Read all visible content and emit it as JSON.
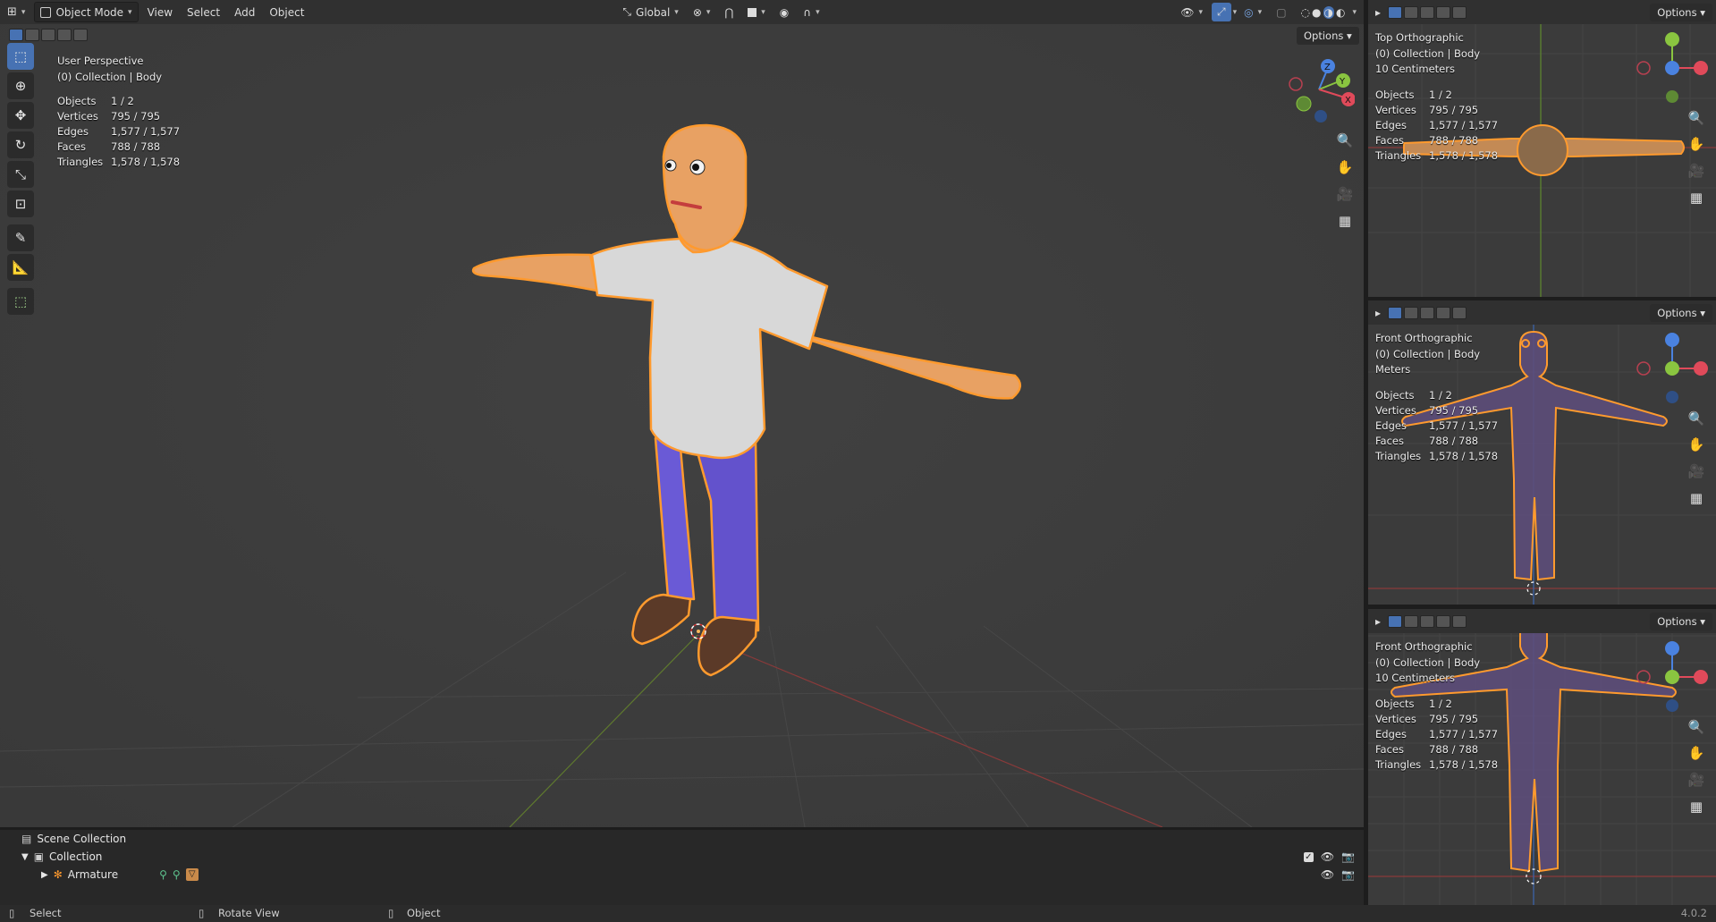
{
  "colors": {
    "accent": "#4772b3",
    "selection": "#ff9a2e",
    "viewport_bg": "#3d3d3d",
    "header_bg": "#303030"
  },
  "header": {
    "editor_icon": "3d-viewport-icon",
    "mode": "Object Mode",
    "menus": [
      "View",
      "Select",
      "Add",
      "Object"
    ],
    "transform_orientation": "Global",
    "options_label": "Options"
  },
  "main_view": {
    "perspective": "User Perspective",
    "collection": "(0) Collection | Body",
    "stats": [
      {
        "label": "Objects",
        "value": "1 / 2"
      },
      {
        "label": "Vertices",
        "value": "795 / 795"
      },
      {
        "label": "Edges",
        "value": "1,577 / 1,577"
      },
      {
        "label": "Faces",
        "value": "788 / 788"
      },
      {
        "label": "Triangles",
        "value": "1,578 / 1,578"
      }
    ],
    "tools": [
      "select-box-icon",
      "cursor-icon",
      "move-icon",
      "rotate-icon",
      "scale-icon",
      "transform-icon",
      "annotate-icon",
      "measure-icon",
      "add-cube-icon"
    ],
    "gizmo": {
      "x": "X",
      "y": "Y",
      "z": "Z"
    }
  },
  "side_views": [
    {
      "view": "Top Orthographic",
      "collection": "(0) Collection | Body",
      "units": "10 Centimeters",
      "options_label": "Options",
      "stats": [
        {
          "label": "Objects",
          "value": "1 / 2"
        },
        {
          "label": "Vertices",
          "value": "795 / 795"
        },
        {
          "label": "Edges",
          "value": "1,577 / 1,577"
        },
        {
          "label": "Faces",
          "value": "788 / 788"
        },
        {
          "label": "Triangles",
          "value": "1,578 / 1,578"
        }
      ]
    },
    {
      "view": "Front Orthographic",
      "collection": "(0) Collection | Body",
      "units": "Meters",
      "options_label": "Options",
      "stats": [
        {
          "label": "Objects",
          "value": "1 / 2"
        },
        {
          "label": "Vertices",
          "value": "795 / 795"
        },
        {
          "label": "Edges",
          "value": "1,577 / 1,577"
        },
        {
          "label": "Faces",
          "value": "788 / 788"
        },
        {
          "label": "Triangles",
          "value": "1,578 / 1,578"
        }
      ]
    },
    {
      "view": "Front Orthographic",
      "collection": "(0) Collection | Body",
      "units": "10 Centimeters",
      "options_label": "Options",
      "stats": [
        {
          "label": "Objects",
          "value": "1 / 2"
        },
        {
          "label": "Vertices",
          "value": "795 / 795"
        },
        {
          "label": "Edges",
          "value": "1,577 / 1,577"
        },
        {
          "label": "Faces",
          "value": "788 / 788"
        },
        {
          "label": "Triangles",
          "value": "1,578 / 1,578"
        }
      ]
    }
  ],
  "outliner": {
    "scene_collection": "Scene Collection",
    "collection": "Collection",
    "armature": "Armature"
  },
  "statusbar": {
    "select": "Select",
    "rotate": "Rotate View",
    "object": "Object",
    "version": "4.0.2"
  }
}
